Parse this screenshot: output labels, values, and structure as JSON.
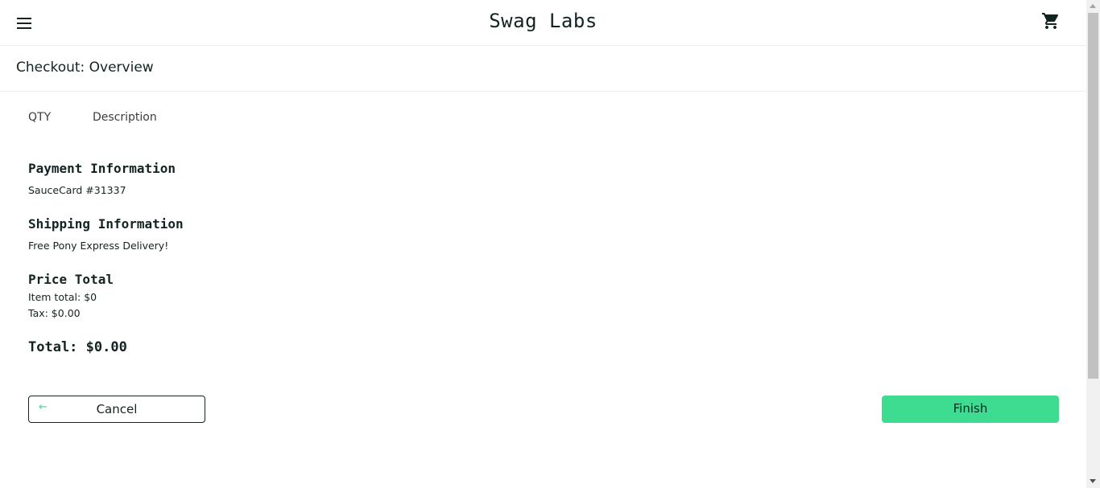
{
  "header": {
    "logo": "Swag Labs",
    "menu_icon": "hamburger-menu-icon",
    "cart_icon": "shopping-cart-icon"
  },
  "page": {
    "title": "Checkout: Overview"
  },
  "list_header": {
    "qty": "QTY",
    "description": "Description"
  },
  "summary": {
    "payment_label": "Payment Information",
    "payment_value": "SauceCard #31337",
    "shipping_label": "Shipping Information",
    "shipping_value": "Free Pony Express Delivery!",
    "price_label": "Price Total",
    "item_total": "Item total: $0",
    "tax": "Tax: $0.00",
    "total": "Total: $0.00"
  },
  "actions": {
    "cancel_label": "Cancel",
    "cancel_icon": "arrow-left-icon",
    "finish_label": "Finish"
  },
  "colors": {
    "accent": "#3ddc91",
    "text": "#132322",
    "divider": "#ededed"
  }
}
